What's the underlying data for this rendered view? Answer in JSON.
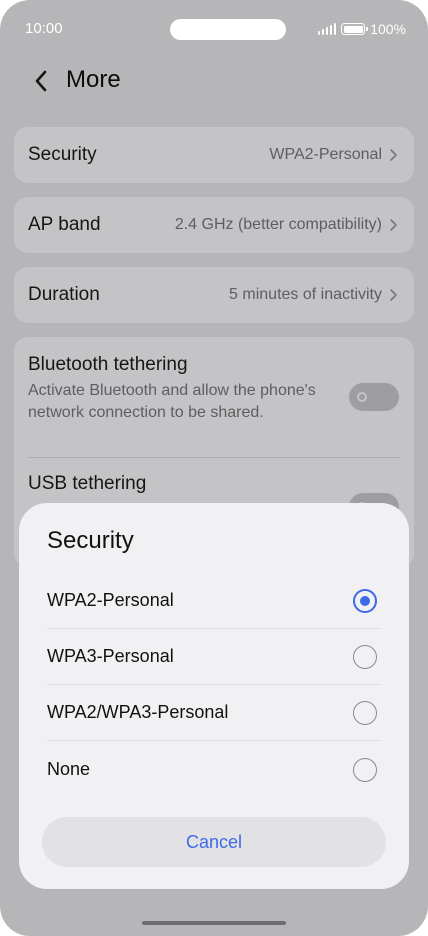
{
  "status_bar": {
    "time": "10:00",
    "battery_text": "100%"
  },
  "header": {
    "title": "More",
    "back_icon": "chevron-left-icon"
  },
  "settings": {
    "security": {
      "label": "Security",
      "value": "WPA2-Personal"
    },
    "ap_band": {
      "label": "AP band",
      "value": "2.4 GHz (better compatibility)"
    },
    "duration": {
      "label": "Duration",
      "value": "5 minutes of inactivity"
    },
    "bluetooth_tethering": {
      "title": "Bluetooth tethering",
      "description": "Activate Bluetooth and allow the phone's network connection to be shared.",
      "enabled": false
    },
    "usb_tethering": {
      "title": "USB tethering",
      "enabled": false
    }
  },
  "dialog": {
    "title": "Security",
    "options": [
      {
        "label": "WPA2-Personal",
        "selected": true
      },
      {
        "label": "WPA3-Personal",
        "selected": false
      },
      {
        "label": "WPA2/WPA3-Personal",
        "selected": false
      },
      {
        "label": "None",
        "selected": false
      }
    ],
    "cancel_label": "Cancel"
  },
  "colors": {
    "accent": "#3e68e6",
    "scrim_background": "#b6b6b8",
    "card": "#c4c4c6",
    "dialog_surface": "#f1f1f3"
  }
}
